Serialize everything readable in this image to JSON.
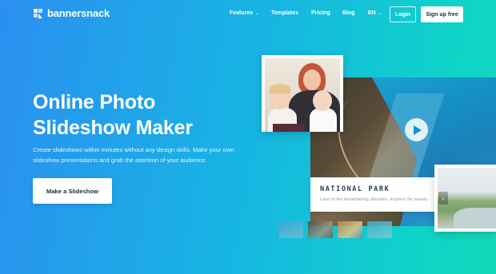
{
  "brand": {
    "name": "bannersnack",
    "icon": "bannersnack-logo-icon"
  },
  "nav": {
    "items": [
      {
        "label": "Features",
        "has_caret": true
      },
      {
        "label": "Templates",
        "has_caret": false
      },
      {
        "label": "Pricing",
        "has_caret": false
      },
      {
        "label": "Blog",
        "has_caret": false
      },
      {
        "label": "EN",
        "has_caret": true
      }
    ],
    "caret_glyph": "⌄",
    "login_label": "Login",
    "signup_label": "Sign up free"
  },
  "hero": {
    "title_line1": "Online Photo",
    "title_line2": "Slideshow Maker",
    "description": "Create slideshows within minutes without any design skills. Make your own slideshow presentations and grab the attention of your audience.",
    "cta_label": "Make a Slideshow"
  },
  "slideshow": {
    "caption_title": "NATIONAL PARK",
    "caption_subtitle": "Land of the breathtaking altitudes. Explore the beauty",
    "prev_arrow": "‹",
    "thumbnail_count": 4
  },
  "colors": {
    "gradient_start": "#2b8ff0",
    "gradient_end": "#14d9b8",
    "button_bg": "#ffffff",
    "button_text": "#1a2b3c"
  }
}
